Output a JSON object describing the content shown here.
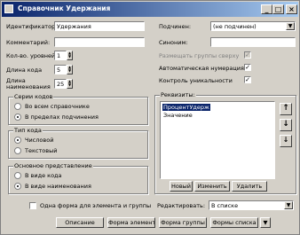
{
  "window": {
    "title": "Справочник Удержания",
    "minimize": "_",
    "maximize": "□",
    "close": "×"
  },
  "left": {
    "identifier_label": "Идентификатор:",
    "identifier_value": "Удержания",
    "comment_label": "Комментарий:",
    "comment_value": "",
    "levels_label": "Кол-во. уровней:",
    "levels_value": "1",
    "code_len_label": "Длина кода",
    "code_len_value": "5",
    "name_len_label_1": "Длина",
    "name_len_label_2": "наименования",
    "name_len_value": "25"
  },
  "right": {
    "subordinate_label": "Подчинен:",
    "subordinate_value": "(не подчинен)",
    "synonym_label": "Синоним:",
    "synonym_value": "",
    "place_groups_label": "Размещать группы сверху",
    "place_groups_checked": true,
    "auto_numbering_label": "Автоматическая нумерация",
    "auto_numbering_checked": true,
    "uniqueness_label": "Контроль уникальности",
    "uniqueness_checked": true
  },
  "series_group": {
    "title": "Серии кодов",
    "options": [
      "Во всем справочнике",
      "В пределах подчинения"
    ],
    "selected": 1
  },
  "code_type_group": {
    "title": "Тип кода",
    "options": [
      "Числовой",
      "Текстовый"
    ],
    "selected": 0
  },
  "main_view_group": {
    "title": "Основное представление",
    "options": [
      "В виде кода",
      "В виде наименования"
    ],
    "selected": 1
  },
  "requisites": {
    "title": "Реквизиты:",
    "items": [
      "ПроцентУдерж",
      "Значение"
    ],
    "selected": 0,
    "buttons": [
      "Новый",
      "Изменить",
      "Удалить"
    ],
    "up_icon": "↑",
    "down_icon": "↓",
    "sort_icon": "↓"
  },
  "bottom": {
    "one_form_label": "Одна форма для элемента и группы",
    "one_form_checked": false,
    "edit_label": "Редактировать:",
    "edit_value": "В списке",
    "buttons": [
      "Описание",
      "Форма элемента",
      "Форма группы",
      "Формы списка"
    ]
  }
}
